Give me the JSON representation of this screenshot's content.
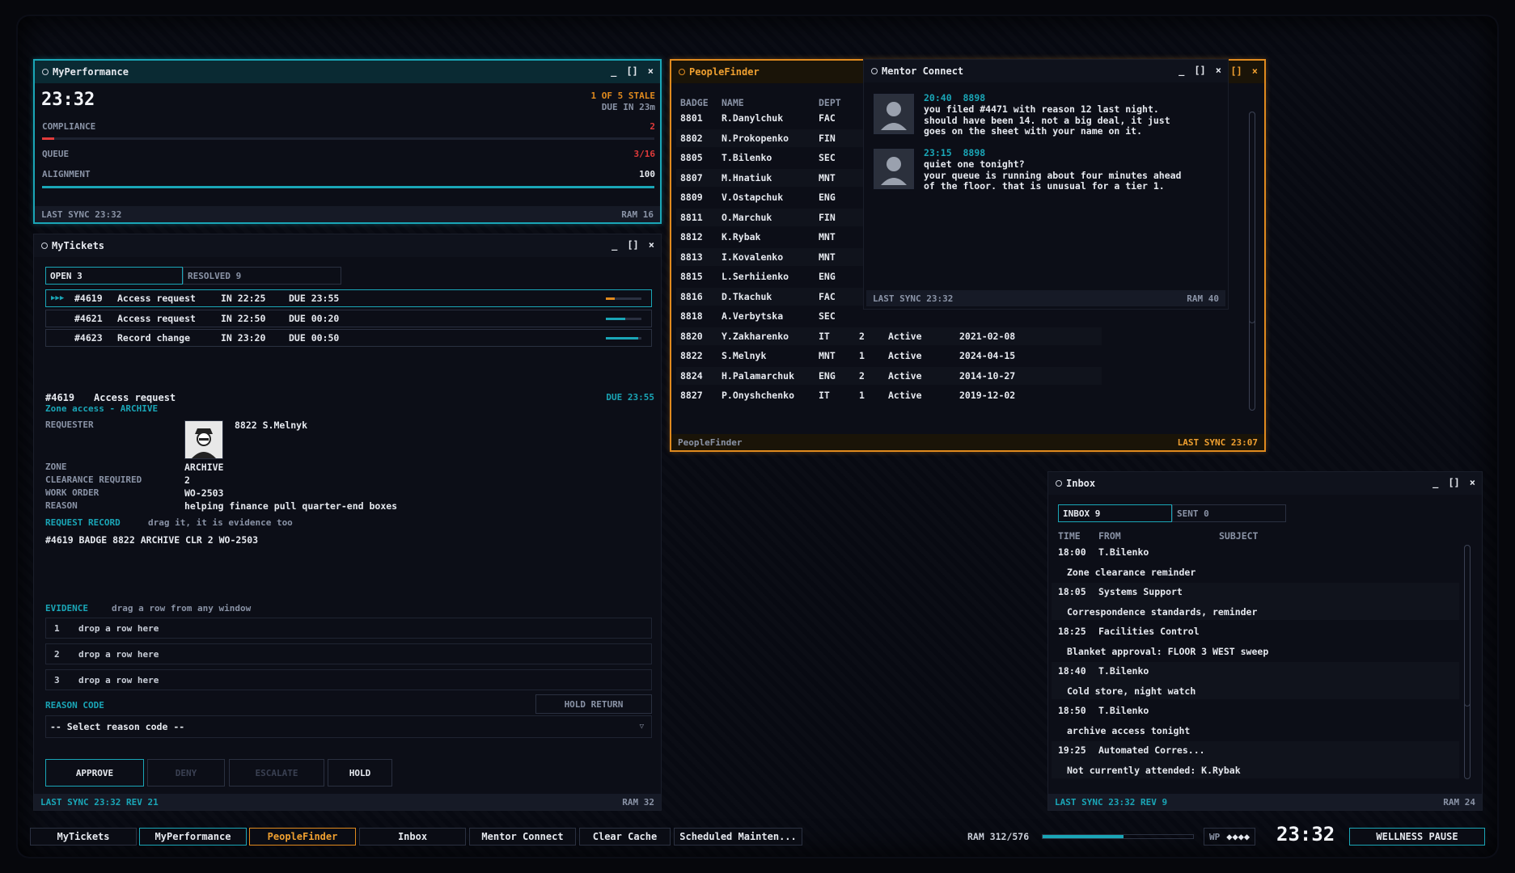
{
  "colors": {
    "accent": "#1aa6b7",
    "orange": "#e08a1e",
    "red": "#e23b3b",
    "muted": "#8a93a6"
  },
  "myperformance": {
    "title": "MyPerformance",
    "time": "23:32",
    "stale": "1 OF 5 STALE",
    "due": "DUE IN 23m",
    "compliance_label": "COMPLIANCE",
    "compliance_value": "2",
    "queue_label": "QUEUE",
    "queue_value": "3/16",
    "alignment_label": "ALIGNMENT",
    "alignment_value": "100",
    "footer_left": "LAST SYNC 23:32",
    "footer_right": "RAM 16"
  },
  "mytickets": {
    "title": "MyTickets",
    "tabs": [
      "OPEN 3",
      "RESOLVED 9"
    ],
    "tickets": [
      {
        "marker": "▶▶▶",
        "id": "#4619",
        "type": "Access request",
        "in": "IN 22:25",
        "due": "DUE 23:55",
        "progress": 0.25,
        "color": "#e08a1e"
      },
      {
        "marker": "",
        "id": "#4621",
        "type": "Access request",
        "in": "IN 22:50",
        "due": "DUE 00:20",
        "progress": 0.55,
        "color": "#1aa6b7"
      },
      {
        "marker": "",
        "id": "#4623",
        "type": "Record change",
        "in": "IN 23:20",
        "due": "DUE 00:50",
        "progress": 0.9,
        "color": "#1aa6b7"
      }
    ],
    "detail": {
      "id": "#4619",
      "type": "Access request",
      "due": "DUE 23:55",
      "subtitle": "Zone access - ARCHIVE",
      "requester_label": "REQUESTER",
      "requester": "8822 S.Melnyk",
      "zone_label": "ZONE",
      "zone": "ARCHIVE",
      "clearance_label": "CLEARANCE REQUIRED",
      "clearance": "2",
      "workorder_label": "WORK ORDER",
      "workorder": "WO-2503",
      "reason_label": "REASON",
      "reason": "helping finance pull quarter-end boxes",
      "record_label": "REQUEST RECORD",
      "record_hint": "drag it, it is evidence too",
      "record": "#4619 BADGE 8822 ARCHIVE CLR 2 WO-2503",
      "evidence_label": "EVIDENCE",
      "evidence_hint": "drag a row from any window",
      "drops": [
        {
          "n": "1",
          "t": "drop a row here"
        },
        {
          "n": "2",
          "t": "drop a row here"
        },
        {
          "n": "3",
          "t": "drop a row here"
        }
      ],
      "reason_code_label": "REASON CODE",
      "hold_return": "HOLD RETURN",
      "select_value": "-- Select reason code --"
    },
    "buttons": {
      "approve": "APPROVE",
      "deny": "DENY",
      "escalate": "ESCALATE",
      "hold": "HOLD"
    },
    "footer_left": "LAST SYNC 23:32 REV 21",
    "footer_right": "RAM 32"
  },
  "peoplefinder": {
    "title": "PeopleFinder",
    "headers": {
      "badge": "BADGE",
      "name": "NAME",
      "dept": "DEPT"
    },
    "rows": [
      {
        "badge": "8801",
        "name": "R.Danylchuk",
        "dept": "FAC",
        "clr": "",
        "status": "",
        "date": ""
      },
      {
        "badge": "8802",
        "name": "N.Prokopenko",
        "dept": "FIN",
        "clr": "",
        "status": "",
        "date": ""
      },
      {
        "badge": "8805",
        "name": "T.Bilenko",
        "dept": "SEC",
        "clr": "",
        "status": "",
        "date": ""
      },
      {
        "badge": "8807",
        "name": "M.Hnatiuk",
        "dept": "MNT",
        "clr": "",
        "status": "",
        "date": ""
      },
      {
        "badge": "8809",
        "name": "V.Ostapchuk",
        "dept": "ENG",
        "clr": "",
        "status": "",
        "date": ""
      },
      {
        "badge": "8811",
        "name": "O.Marchuk",
        "dept": "FIN",
        "clr": "",
        "status": "",
        "date": ""
      },
      {
        "badge": "8812",
        "name": "K.Rybak",
        "dept": "MNT",
        "clr": "",
        "status": "",
        "date": ""
      },
      {
        "badge": "8813",
        "name": "I.Kovalenko",
        "dept": "MNT",
        "clr": "",
        "status": "",
        "date": ""
      },
      {
        "badge": "8815",
        "name": "L.Serhiienko",
        "dept": "ENG",
        "clr": "",
        "status": "",
        "date": ""
      },
      {
        "badge": "8816",
        "name": "D.Tkachuk",
        "dept": "FAC",
        "clr": "",
        "status": "",
        "date": ""
      },
      {
        "badge": "8818",
        "name": "A.Verbytska",
        "dept": "SEC",
        "clr": "",
        "status": "",
        "date": ""
      },
      {
        "badge": "8820",
        "name": "Y.Zakharenko",
        "dept": "IT",
        "clr": "2",
        "status": "Active",
        "date": "2021-02-08"
      },
      {
        "badge": "8822",
        "name": "S.Melnyk",
        "dept": "MNT",
        "clr": "1",
        "status": "Active",
        "date": "2024-04-15"
      },
      {
        "badge": "8824",
        "name": "H.Palamarchuk",
        "dept": "ENG",
        "clr": "2",
        "status": "Active",
        "date": "2014-10-27"
      },
      {
        "badge": "8827",
        "name": "P.Onyshchenko",
        "dept": "IT",
        "clr": "1",
        "status": "Active",
        "date": "2019-12-02"
      }
    ],
    "footer_left": "PeopleFinder",
    "footer_right": "LAST SYNC 23:07"
  },
  "mentor": {
    "title": "Mentor Connect",
    "messages": [
      {
        "time": "20:40",
        "badge": "8898",
        "text": [
          "you filed #4471 with reason 12 last night.",
          "should have been 14. not a big deal, it just",
          "goes on the sheet with your name on it."
        ]
      },
      {
        "time": "23:15",
        "badge": "8898",
        "text": [
          "quiet one tonight?",
          "your queue is running about four minutes ahead",
          "of the floor. that is unusual for a tier 1."
        ]
      }
    ],
    "footer_left": "LAST SYNC 23:32",
    "footer_right": "RAM 40"
  },
  "inbox": {
    "title": "Inbox",
    "tabs": [
      "INBOX 9",
      "SENT 0"
    ],
    "headers": {
      "time": "TIME",
      "from": "FROM",
      "subject": "SUBJECT"
    },
    "items": [
      {
        "time": "18:00",
        "from": "T.Bilenko",
        "subject": "Zone clearance reminder"
      },
      {
        "time": "18:05",
        "from": "Systems Support",
        "subject": "Correspondence standards, reminder"
      },
      {
        "time": "18:25",
        "from": "Facilities Control",
        "subject": "Blanket approval: FLOOR 3 WEST sweep"
      },
      {
        "time": "18:40",
        "from": "T.Bilenko",
        "subject": "Cold store, night watch"
      },
      {
        "time": "18:50",
        "from": "T.Bilenko",
        "subject": "archive access tonight"
      },
      {
        "time": "19:25",
        "from": "Automated Corres...",
        "subject": "Not currently attended: K.Rybak"
      }
    ],
    "footer_left": "LAST SYNC 23:32 REV 9",
    "footer_right": "RAM 24"
  },
  "taskbar": {
    "items": [
      "MyTickets",
      "MyPerformance",
      "PeopleFinder",
      "Inbox",
      "Mentor Connect",
      "Clear Cache",
      "Scheduled Mainten..."
    ],
    "ram": "RAM 312/576",
    "ram_fraction": 0.54,
    "wp_label": "WP",
    "wp_value": "◆◆◆◆",
    "clock": "23:32",
    "wellness": "WELLNESS PAUSE"
  },
  "window_controls": {
    "min": "_",
    "max": "[]",
    "close": "×"
  }
}
